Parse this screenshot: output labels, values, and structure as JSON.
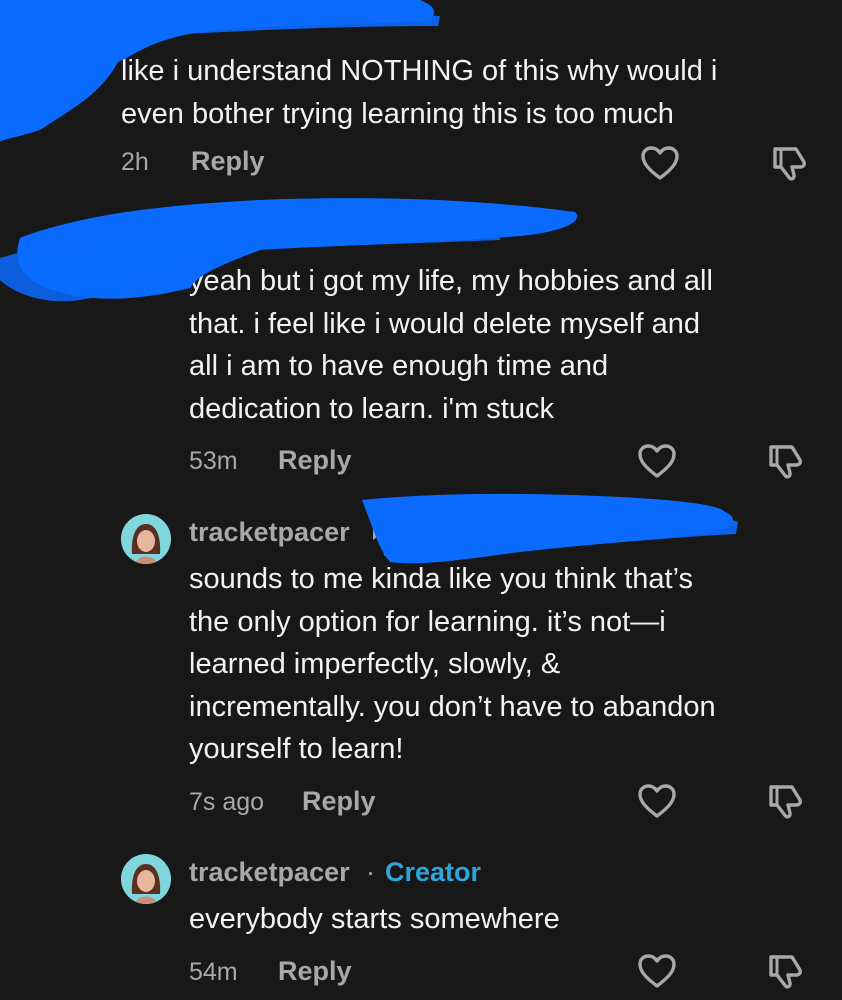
{
  "theme": {
    "background": "#181818",
    "text": "#f2f2f2",
    "muted": "#a8a8a8",
    "creator_badge": "#2ea6d9",
    "redaction": "#0b6bff",
    "avatar_bg": "#7fd6dc"
  },
  "comments": [
    {
      "text": "like i understand NOTHING of this why would i\neven bother trying learning this is too much",
      "time": "2h",
      "reply": "Reply",
      "like_icon": "heart-outline-icon",
      "dislike_icon": "thumbs-down-icon"
    },
    {
      "text": "yeah but i got my life, my hobbies and all\nthat. i feel like i would delete myself and\nall i am to have enough time and\ndedication to learn. i'm stuck",
      "time": "53m",
      "reply": "Reply",
      "like_icon": "heart-outline-icon",
      "dislike_icon": "thumbs-down-icon"
    },
    {
      "username": "tracketpacer",
      "text": "sounds to me kinda like you think that’s\nthe only option for learning. it’s not—i\nlearned imperfectly, slowly, &\nincrementally. you don’t have to abandon\nyourself to learn!",
      "time": "7s ago",
      "reply": "Reply",
      "like_icon": "heart-outline-icon",
      "dislike_icon": "thumbs-down-icon"
    },
    {
      "username": "tracketpacer",
      "separator": "·",
      "badge": "Creator",
      "text": "everybody starts somewhere",
      "time": "54m",
      "reply": "Reply",
      "like_icon": "heart-outline-icon",
      "dislike_icon": "thumbs-down-icon"
    }
  ]
}
